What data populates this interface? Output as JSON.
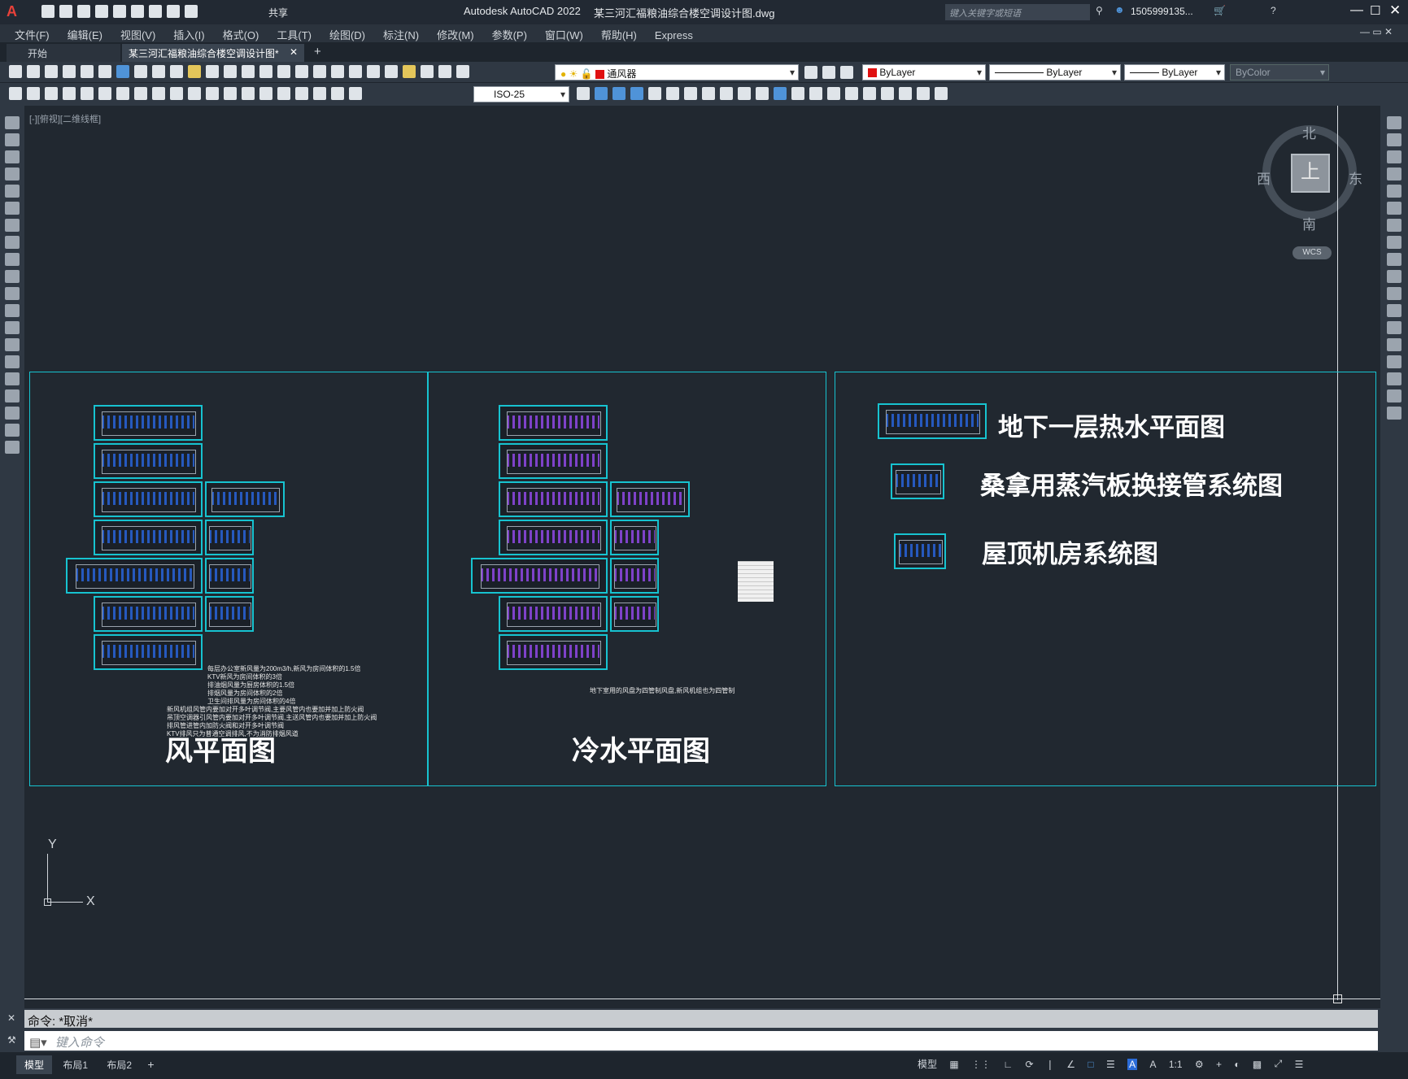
{
  "app": {
    "name": "Autodesk AutoCAD 2022",
    "file": "某三河汇福粮油综合楼空调设计图.dwg",
    "share": "共享"
  },
  "search": {
    "placeholder": "键入关键字或短语"
  },
  "user": {
    "name": "1505999135..."
  },
  "menu": [
    "文件(F)",
    "编辑(E)",
    "视图(V)",
    "插入(I)",
    "格式(O)",
    "工具(T)",
    "绘图(D)",
    "标注(N)",
    "修改(M)",
    "参数(P)",
    "窗口(W)",
    "帮助(H)",
    "Express"
  ],
  "tabs": [
    {
      "label": "开始"
    },
    {
      "label": "某三河汇福粮油综合楼空调设计图*"
    }
  ],
  "layer": {
    "name": "通风器",
    "color": "#e01010"
  },
  "props": {
    "color": "ByLayer",
    "linetype": "ByLayer",
    "lineweight": "ByLayer",
    "plotstyle": "ByColor"
  },
  "dimstyle": "ISO-25",
  "viewport_label": "[-][俯视][二维线框]",
  "viewcube": {
    "north": "北",
    "south": "南",
    "east": "东",
    "west": "西",
    "face": "上",
    "wcs": "WCS"
  },
  "drawing": {
    "panel1_title": "风平面图",
    "panel2_title": "冷水平面图",
    "legend": [
      "地下一层热水平面图",
      "桑拿用蒸汽板换接管系统图",
      "屋顶机房系统图"
    ],
    "notes1": [
      "每层办公室新风量为200m3/h,新风为房间体积的1.5倍",
      "KTV新风为房间体积的3倍",
      "排油烟风量为厨房体积的1.5倍",
      "排烟风量为房间体积的2倍",
      "卫生间排风量为房间体积的4倍",
      "新风机组风管内要加对开多叶调节阀,主要风管内也要加并加上防火阀",
      "吊顶空调器引风管内要加对开多叶调节阀,主送风管内也要加并加上防火阀",
      "排风管进管内加防火阀和对开多叶调节阀",
      "KTV排风只为普通空调排风,不为消防排烟风道"
    ],
    "notes2": [
      "地下室用的风盘为四管制风盘,新风机组也为四管制"
    ]
  },
  "ucs": {
    "x": "X",
    "y": "Y"
  },
  "command": {
    "history": "命令: *取消*",
    "placeholder": "键入命令"
  },
  "layout_tabs": [
    "模型",
    "布局1",
    "布局2"
  ],
  "status": {
    "model": "模型",
    "scale": "1:1"
  }
}
